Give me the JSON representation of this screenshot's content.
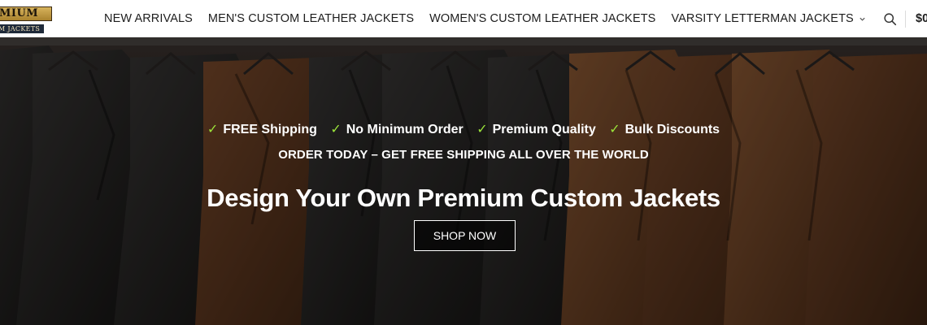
{
  "header": {
    "logo": {
      "top_text": "MIUM",
      "bottom_text": "M JACKETS"
    },
    "nav": [
      {
        "label": "NEW ARRIVALS"
      },
      {
        "label": "MEN'S CUSTOM LEATHER JACKETS"
      },
      {
        "label": "WOMEN'S CUSTOM LEATHER JACKETS"
      },
      {
        "label": "VARSITY LETTERMAN JACKETS",
        "has_dropdown": true
      }
    ],
    "cart_total": "$0",
    "icons": {
      "search": "search-icon",
      "dropdown": "chevron-down-icon",
      "check": "check-icon"
    }
  },
  "hero": {
    "features": [
      {
        "label": "FREE Shipping"
      },
      {
        "label": "No Minimum Order"
      },
      {
        "label": "Premium Quality"
      },
      {
        "label": "Bulk Discounts"
      }
    ],
    "check_color": "#9be33a",
    "tagline": "ORDER TODAY – GET FREE SHIPPING ALL OVER THE WORLD",
    "headline": "Design Your Own Premium Custom Jackets",
    "cta_label": "SHOP NOW"
  }
}
